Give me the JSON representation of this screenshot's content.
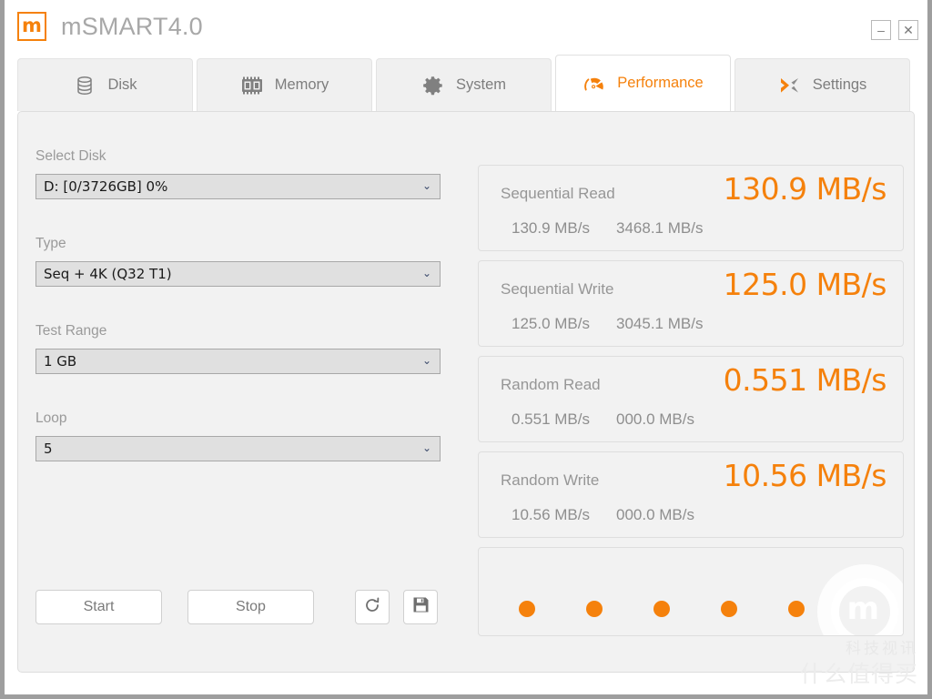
{
  "window": {
    "title": "mSMART4.0",
    "logo_glyph": "m",
    "minimize_label": "–",
    "close_label": "✕"
  },
  "tabs": [
    {
      "label": "Disk",
      "icon": "database-icon",
      "active": false
    },
    {
      "label": "Memory",
      "icon": "memory-chip-icon",
      "active": false
    },
    {
      "label": "System",
      "icon": "gear-icon",
      "active": false
    },
    {
      "label": "Performance",
      "icon": "speedometer-icon",
      "active": true
    },
    {
      "label": "Settings",
      "icon": "cross-arrows-icon",
      "active": false
    }
  ],
  "left_panel": {
    "fields": [
      {
        "label": "Select Disk",
        "value": "D: [0/3726GB] 0%",
        "name": "select-disk"
      },
      {
        "label": "Type",
        "value": "Seq + 4K (Q32 T1)",
        "name": "type"
      },
      {
        "label": "Test Range",
        "value": "1 GB",
        "name": "test-range"
      },
      {
        "label": "Loop",
        "value": "5",
        "name": "loop"
      }
    ],
    "buttons": {
      "start": "Start",
      "stop": "Stop",
      "refresh_icon": "refresh-icon",
      "save_icon": "save-floppy-icon"
    }
  },
  "results": [
    {
      "name": "Sequential Read",
      "main": "130.9 MB/s",
      "sub1": "130.9 MB/s",
      "sub2": "3468.1 MB/s"
    },
    {
      "name": "Sequential Write",
      "main": "125.0 MB/s",
      "sub1": "125.0 MB/s",
      "sub2": "3045.1 MB/s"
    },
    {
      "name": "Random Read",
      "main": "0.551 MB/s",
      "sub1": "0.551 MB/s",
      "sub2": "000.0 MB/s"
    },
    {
      "name": "Random Write",
      "main": "10.56 MB/s",
      "sub1": "10.56 MB/s",
      "sub2": "000.0 MB/s"
    }
  ],
  "progress": {
    "dot_count": 5,
    "dots": [
      "1",
      "2",
      "3",
      "4",
      "5"
    ]
  },
  "watermark": {
    "logo_letter": "m",
    "line1": "科技视讯",
    "line2": "什么值得买"
  },
  "colors": {
    "accent": "#f5810c",
    "label_gray": "#9a9a9a",
    "panel_bg": "#f2f2f2",
    "window_border": "#9e9e9e"
  }
}
